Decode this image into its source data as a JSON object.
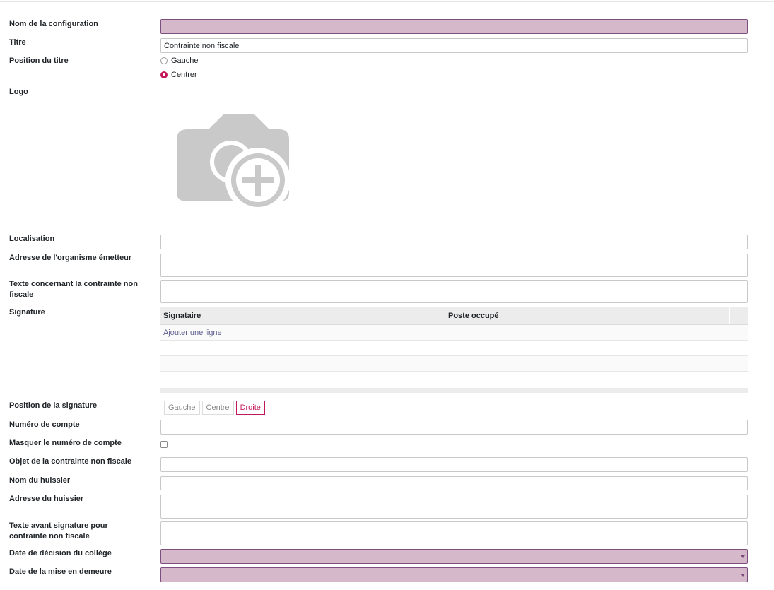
{
  "fields": {
    "nom_configuration": {
      "label": "Nom de la configuration",
      "value": ""
    },
    "titre": {
      "label": "Titre",
      "value": "Contrainte non fiscale"
    },
    "position_titre": {
      "label": "Position du titre",
      "options": [
        "Gauche",
        "Centrer"
      ],
      "selected": "Centrer"
    },
    "logo": {
      "label": "Logo",
      "icon": "camera-add-icon"
    },
    "localisation": {
      "label": "Localisation",
      "value": ""
    },
    "adresse_organisme": {
      "label": "Adresse de l'organisme émetteur",
      "value": ""
    },
    "texte_contrainte": {
      "label": "Texte concernant la contrainte non fiscale",
      "value": ""
    },
    "signature": {
      "label": "Signature",
      "columns": [
        "Signataire",
        "Poste occupé"
      ],
      "add_line": "Ajouter une ligne"
    },
    "position_signature": {
      "label": "Position de la signature",
      "options": [
        "Gauche",
        "Centre",
        "Droite"
      ],
      "selected": "Droite"
    },
    "numero_compte": {
      "label": "Numéro de compte",
      "value": ""
    },
    "masquer_numero": {
      "label": "Masquer le numéro de compte",
      "checked": false
    },
    "objet_contrainte": {
      "label": "Objet de la contrainte non fiscale",
      "value": ""
    },
    "nom_huissier": {
      "label": "Nom du huissier",
      "value": ""
    },
    "adresse_huissier": {
      "label": "Adresse du huissier",
      "value": ""
    },
    "texte_avant_signature": {
      "label": "Texte avant signature pour contrainte non fiscale",
      "value": ""
    },
    "date_decision": {
      "label": "Date de décision du collège",
      "value": ""
    },
    "date_mise_demeure": {
      "label": "Date de la mise en demeure",
      "value": ""
    }
  },
  "colors": {
    "required_bg": "#d6b8cb",
    "accent": "#c2185b"
  }
}
